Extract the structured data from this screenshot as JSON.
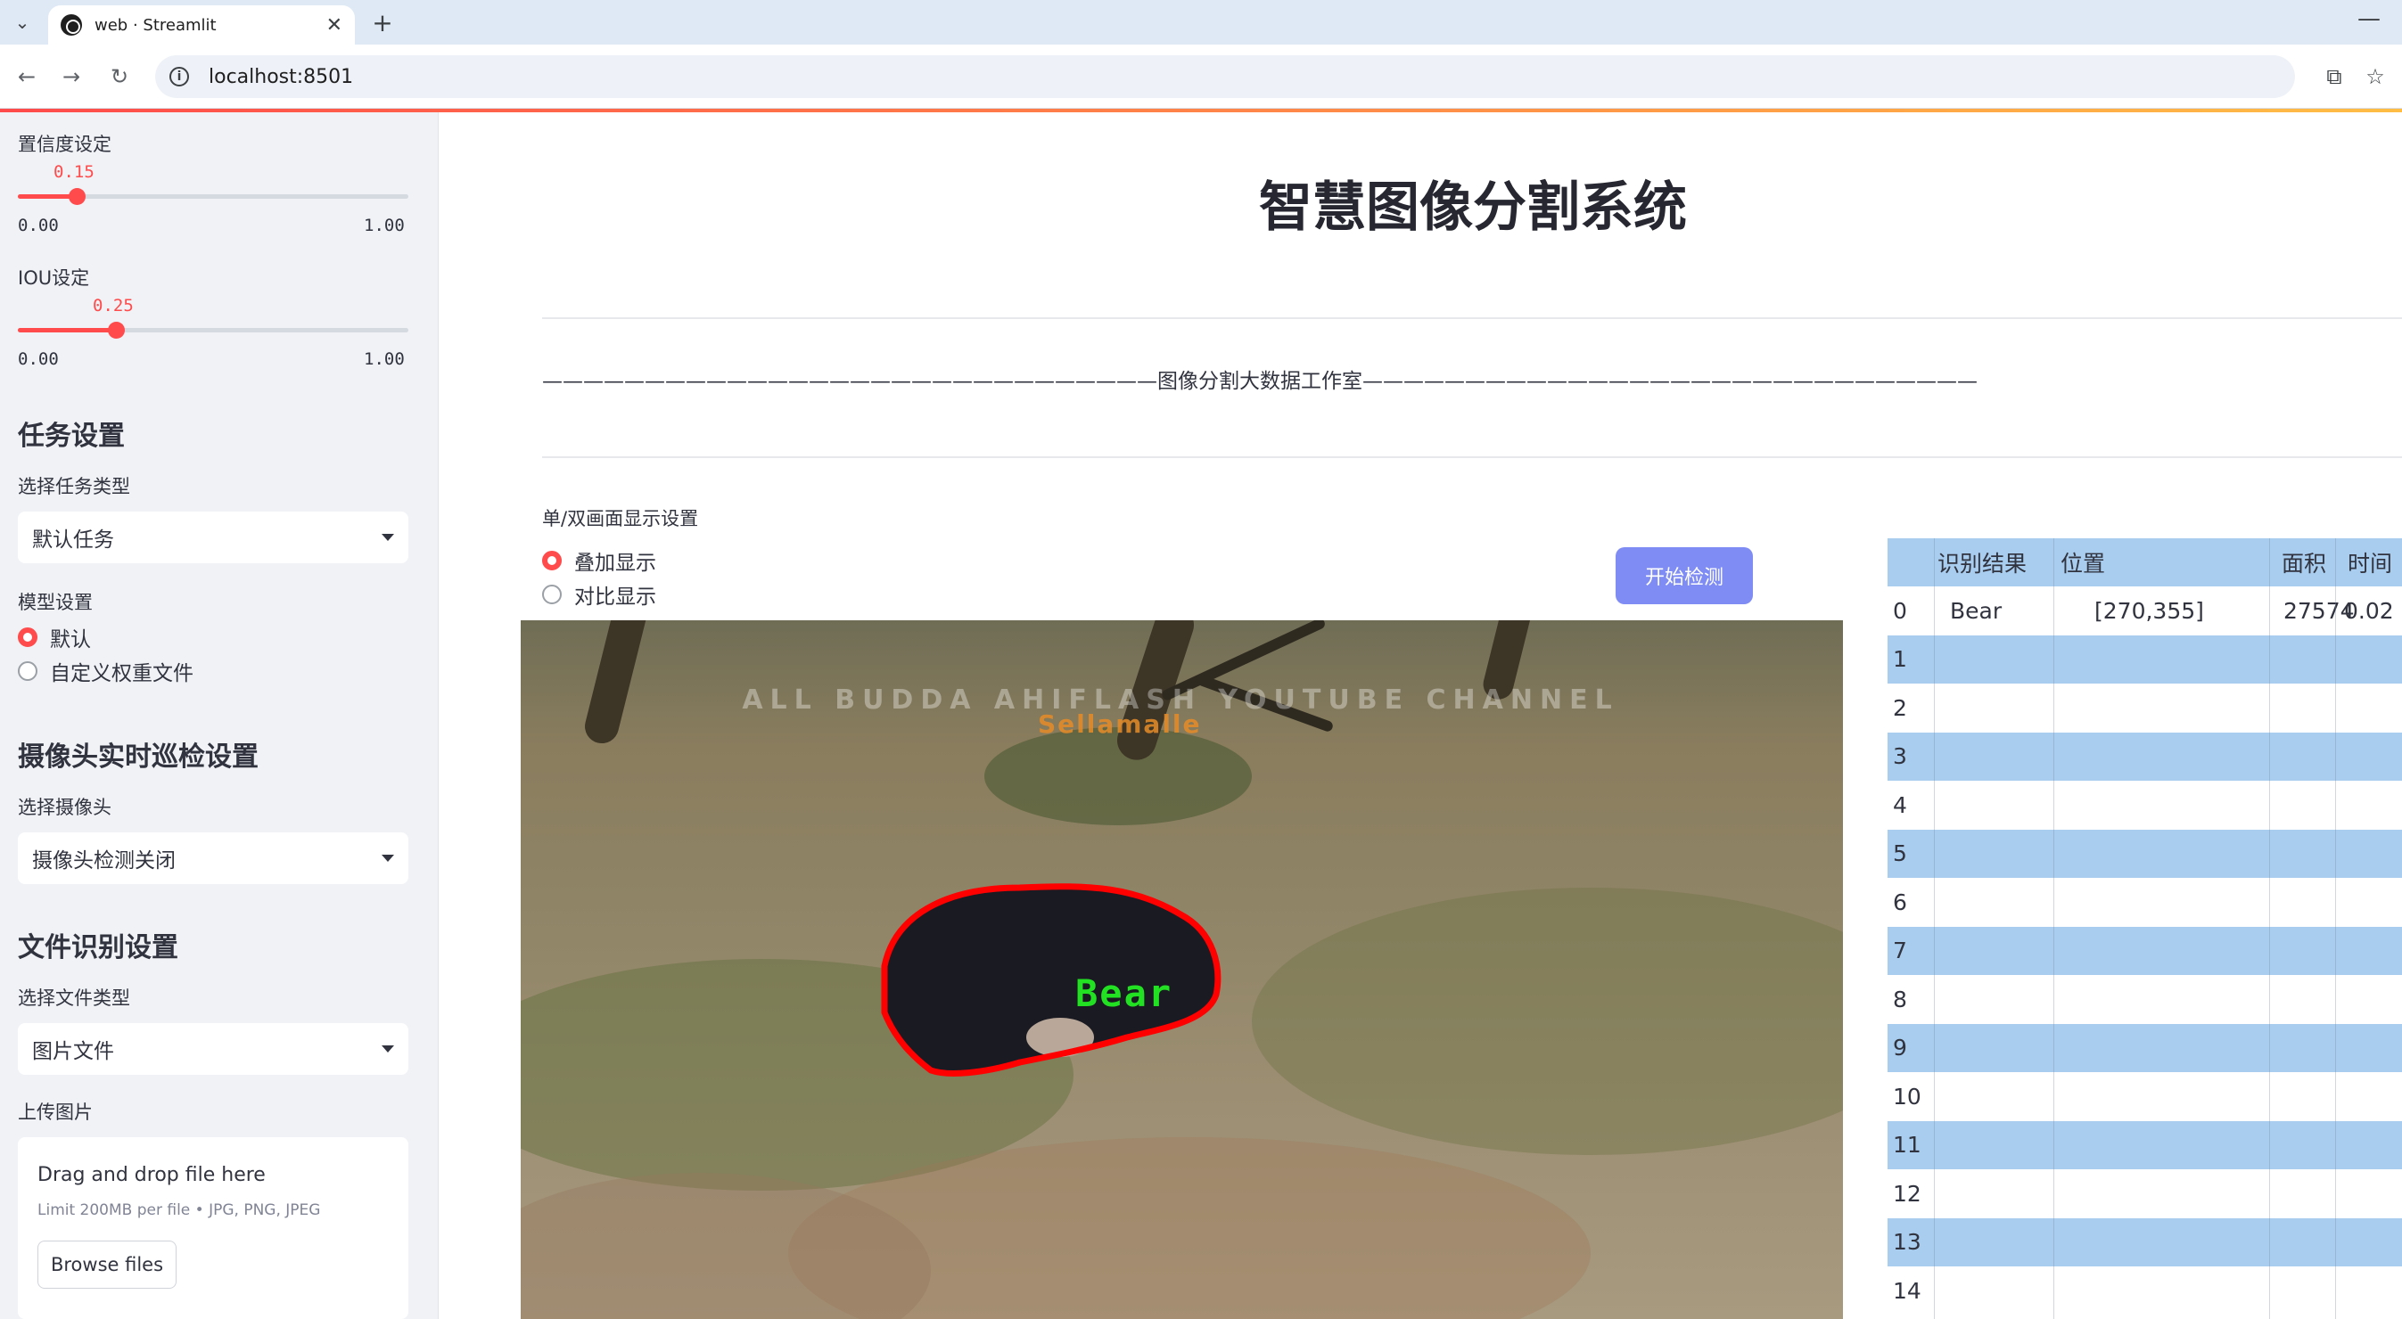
{
  "browser": {
    "tab_title": "web · Streamlit",
    "url": "localhost:8501"
  },
  "sidebar": {
    "confidence": {
      "label": "置信度设定",
      "value": "0.15",
      "min": "0.00",
      "max": "1.00",
      "fraction": 0.15
    },
    "iou": {
      "label": "IOU设定",
      "value": "0.25",
      "min": "0.00",
      "max": "1.00",
      "fraction": 0.25
    },
    "task_heading": "任务设置",
    "task_type_label": "选择任务类型",
    "task_type_value": "默认任务",
    "model_label": "模型设置",
    "model_options": [
      {
        "label": "默认",
        "selected": true
      },
      {
        "label": "自定义权重文件",
        "selected": false
      }
    ],
    "camera_heading": "摄像头实时巡检设置",
    "camera_label": "选择摄像头",
    "camera_value": "摄像头检测关闭",
    "file_heading": "文件识别设置",
    "file_type_label": "选择文件类型",
    "file_type_value": "图片文件",
    "upload_label": "上传图片",
    "upload": {
      "title": "Drag and drop file here",
      "subtitle": "Limit 200MB per file • JPG, PNG, JPEG",
      "button": "Browse files"
    }
  },
  "main": {
    "title": "智慧图像分割系统",
    "divider_text": "——————————————————————————————图像分割大数据工作室——————————————————————————————",
    "display_label": "单/双画面显示设置",
    "display_options": [
      {
        "label": "叠加显示",
        "selected": true
      },
      {
        "label": "对比显示",
        "selected": false
      }
    ],
    "start_button": "开始检测",
    "detection_label": "Bear",
    "watermark": "ALL BUDDA AHIFLASH YOUTUBE CHANNEL",
    "watermark2": "Sellamalle"
  },
  "table": {
    "headers": [
      "识别结果",
      "位置",
      "面积",
      "时间"
    ],
    "rows": [
      {
        "idx": "0",
        "result": "Bear",
        "position": "[270,355]",
        "area": "27574",
        "time": "0.02"
      },
      {
        "idx": "1",
        "result": "",
        "position": "",
        "area": "",
        "time": ""
      },
      {
        "idx": "2",
        "result": "",
        "position": "",
        "area": "",
        "time": ""
      },
      {
        "idx": "3",
        "result": "",
        "position": "",
        "area": "",
        "time": ""
      },
      {
        "idx": "4",
        "result": "",
        "position": "",
        "area": "",
        "time": ""
      },
      {
        "idx": "5",
        "result": "",
        "position": "",
        "area": "",
        "time": ""
      },
      {
        "idx": "6",
        "result": "",
        "position": "",
        "area": "",
        "time": ""
      },
      {
        "idx": "7",
        "result": "",
        "position": "",
        "area": "",
        "time": ""
      },
      {
        "idx": "8",
        "result": "",
        "position": "",
        "area": "",
        "time": ""
      },
      {
        "idx": "9",
        "result": "",
        "position": "",
        "area": "",
        "time": ""
      },
      {
        "idx": "10",
        "result": "",
        "position": "",
        "area": "",
        "time": ""
      },
      {
        "idx": "11",
        "result": "",
        "position": "",
        "area": "",
        "time": ""
      },
      {
        "idx": "12",
        "result": "",
        "position": "",
        "area": "",
        "time": ""
      },
      {
        "idx": "13",
        "result": "",
        "position": "",
        "area": "",
        "time": ""
      },
      {
        "idx": "14",
        "result": "",
        "position": "",
        "area": "",
        "time": ""
      }
    ]
  },
  "colors": {
    "accent": "#ff4b4b",
    "button": "#7f8cf3",
    "table_stripe": "#a8cdef",
    "mask_outline": "#ff0000",
    "label_text": "#22e022"
  }
}
